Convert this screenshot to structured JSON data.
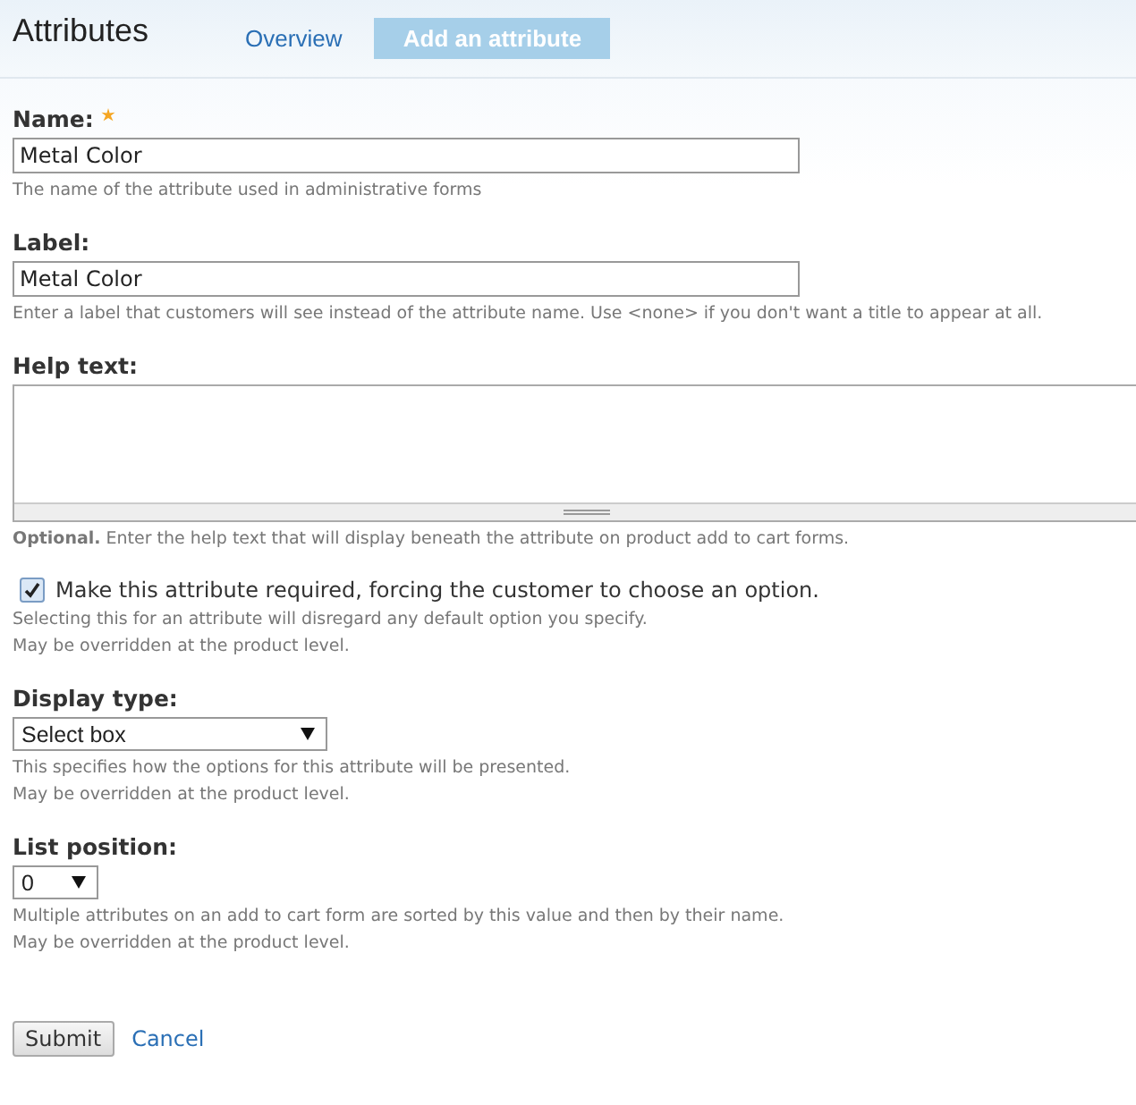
{
  "header": {
    "title": "Attributes",
    "tabs": [
      {
        "label": "Overview",
        "selected": false
      },
      {
        "label": "Add an attribute",
        "selected": true
      }
    ]
  },
  "fields": [
    {
      "kind": "text",
      "label": "Name:",
      "required": true,
      "value": "Metal Color",
      "descriptions": [
        "The name of the attribute used in administrative forms"
      ]
    },
    {
      "kind": "text",
      "label": "Label:",
      "required": false,
      "value": "Metal Color",
      "descriptions": [
        "Enter a label that customers will see instead of the attribute name. Use <none> if you don't want a title to appear at all."
      ]
    },
    {
      "kind": "textarea",
      "label": "Help text:",
      "required": false,
      "descriptions": [
        "**Optional.** Enter the help text that will display beneath the attribute on product add to cart forms."
      ]
    },
    {
      "kind": "checkbox",
      "label": "Make this attribute required, forcing the customer to choose an option.",
      "checked": true,
      "descriptions": [
        "Selecting this for an attribute will disregard any default option you specify.",
        "May be overridden at the product level."
      ]
    },
    {
      "kind": "select",
      "label": "Display type:",
      "required": false,
      "value": "Select box",
      "descriptions": [
        "This specifies how the options for this attribute will be presented.",
        "May be overridden at the product level."
      ]
    },
    {
      "kind": "select-small",
      "label": "List position:",
      "required": false,
      "value": "0",
      "descriptions": [
        "Multiple attributes on an add to cart form are sorted by this value and then by their name.",
        "May be overridden at the product level."
      ]
    }
  ],
  "actions": {
    "submit": "Submit",
    "cancel": "Cancel"
  }
}
